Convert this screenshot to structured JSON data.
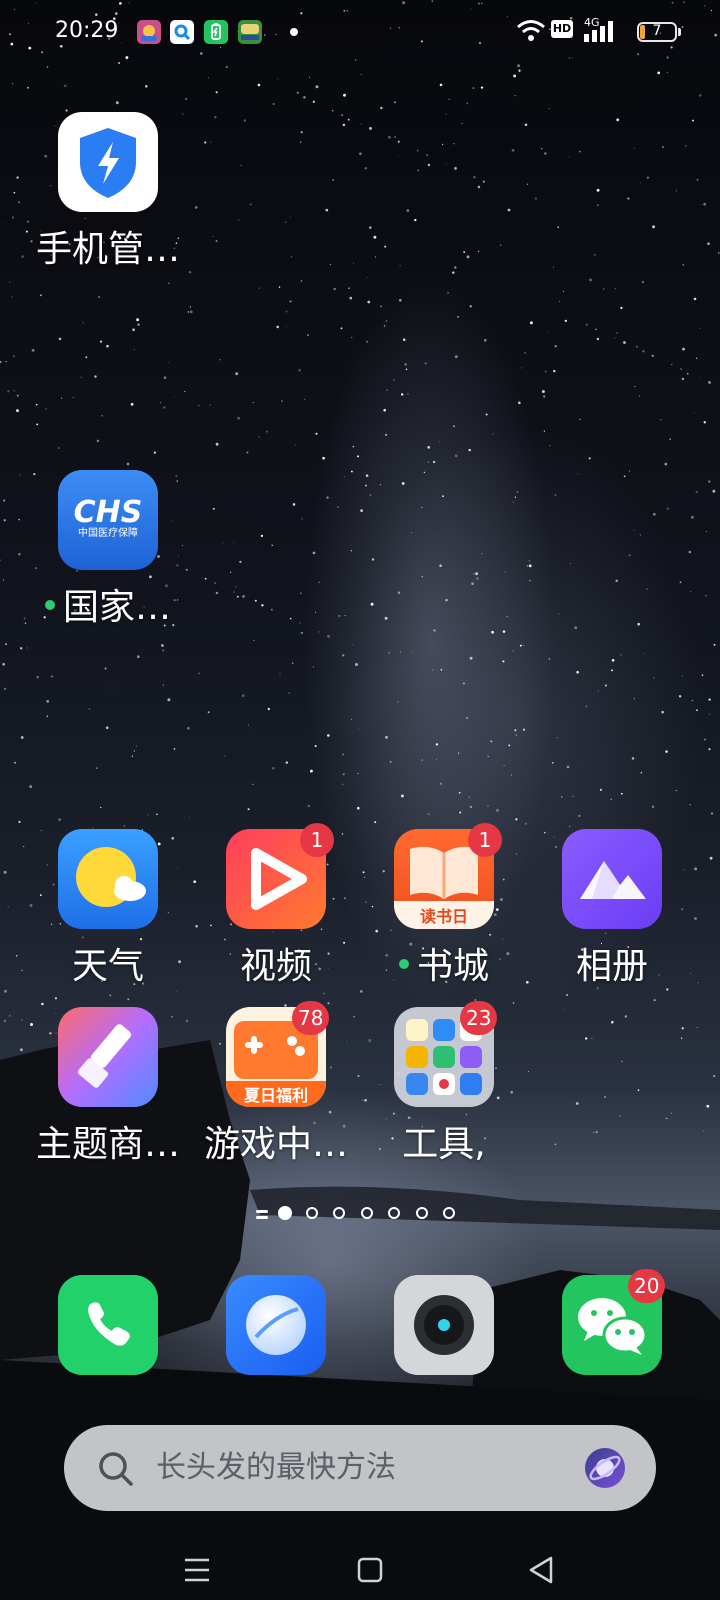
{
  "status_bar": {
    "time": "20:29",
    "notification_icons": [
      "game-icon",
      "qq-browser-icon",
      "battery-manager-icon",
      "game-icon"
    ],
    "network_label": "4G",
    "hd_label": "HD",
    "battery_level": "7"
  },
  "apps": {
    "phone_manager": {
      "label": "手机管…",
      "icon": "shield-bolt-icon"
    },
    "nhsa": {
      "label": "国家…",
      "icon": "chs-icon",
      "icon_text": "CHS",
      "icon_subtitle": "中国医疗保障"
    },
    "weather": {
      "label": "天气",
      "icon": "sun-cloud-icon"
    },
    "video": {
      "label": "视频",
      "icon": "play-icon",
      "badge": "1"
    },
    "books": {
      "label": "书城",
      "icon": "book-icon",
      "badge": "1",
      "icon_text": "读书日"
    },
    "gallery": {
      "label": "相册",
      "icon": "mountain-icon"
    },
    "themes": {
      "label": "主题商…",
      "icon": "brush-icon"
    },
    "game_center": {
      "label": "游戏中…",
      "icon": "gamepad-icon",
      "badge": "78",
      "icon_text": "夏日福利"
    },
    "tools": {
      "label": "工具,",
      "icon": "folder-icon",
      "badge": "23"
    }
  },
  "dock": {
    "phone": {
      "icon": "phone-icon"
    },
    "browser": {
      "icon": "browser-icon"
    },
    "camera": {
      "icon": "camera-icon"
    },
    "wechat": {
      "icon": "wechat-icon",
      "badge": "20"
    }
  },
  "page_indicator": {
    "pages": 7,
    "current": 1
  },
  "search": {
    "placeholder": "长头发的最快方法"
  },
  "colors": {
    "badge": "#e53844",
    "new_dot": "#2ecc71",
    "accent_blue": "#2a7df2"
  }
}
